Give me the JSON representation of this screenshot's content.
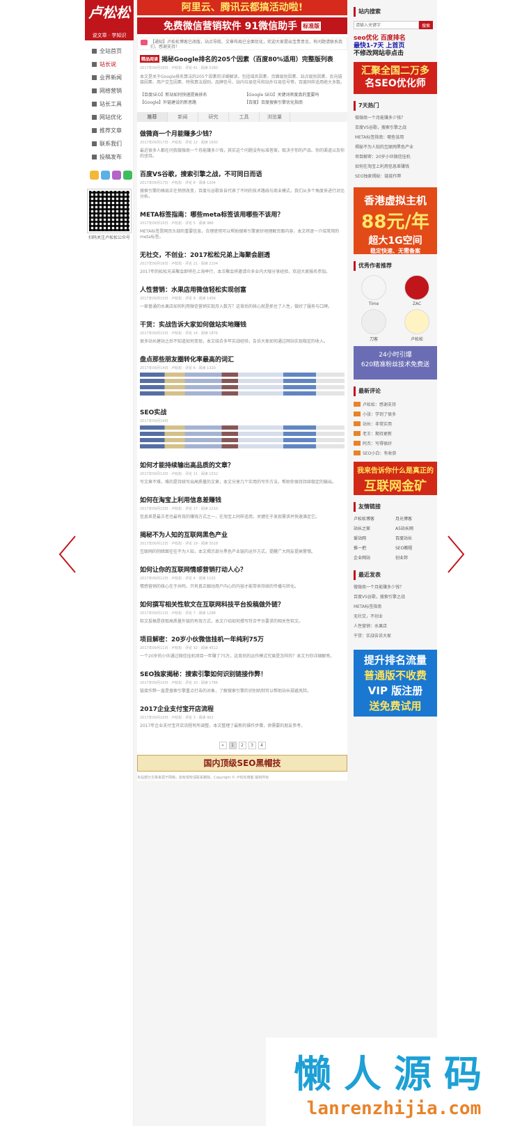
{
  "logo": {
    "text": "卢松松",
    "sub": "说文章 · 学知识"
  },
  "nav": [
    {
      "label": "全站首页",
      "active": false
    },
    {
      "label": "站长说",
      "active": true
    },
    {
      "label": "业界新闻",
      "active": false
    },
    {
      "label": "网络营销",
      "active": false
    },
    {
      "label": "站长工具",
      "active": false
    },
    {
      "label": "网站优化",
      "active": false
    },
    {
      "label": "推荐文章",
      "active": false
    },
    {
      "label": "联系我们",
      "active": false
    },
    {
      "label": "投稿发布",
      "active": false
    }
  ],
  "qr_caption": "扫码关注卢松松公众号",
  "banner1": "阿里云、腾讯云都搞活动啦!",
  "banner2": {
    "text": "免费微信营销软件   91微信助手",
    "tag": "标准版"
  },
  "notice": "【通知】卢松松博客已改版，站点导航、文章布局已全面优化，欢迎大家提出宝贵意见，有问题请联系我们，感谢支持！",
  "featured": {
    "badge": "精品阅读",
    "title": "揭秘Google排名的205个因素（百度80%适用）完整版列表",
    "meta": "2017年09月18日 · 卢松松 · 评论 41 · 阅读 5280",
    "summary": "本文是关于Google排名算法的205个因素的详细解读，包括域名因素、页面级别因素、站点级别因素、反向链接因素、用户交互因素、特殊算法规则、品牌信号、站内垃圾信号和站外垃圾信号等，百度同样适用绝大多数。",
    "related": [
      "【百度SEO】新站如何快速提高排名",
      "【Google SEO】关键词密度真的重要吗",
      "【Google】外链建设的新思路",
      "【百度】百度搜索引擎优化指南"
    ]
  },
  "tabs": [
    "推荐",
    "新闻",
    "研究",
    "工具",
    "浏览量"
  ],
  "posts": [
    {
      "title": "做微商一个月能赚多少钱？",
      "meta": "2017年09月17日 · 卢松松 · 评论 12 · 阅读 1630",
      "body": "最近很多人都在问我做微商一个月能赚多少钱，其实这个问题没有标准答案，取决于你的产品、你的渠道以及你的坚持。"
    },
    {
      "title": "百度VS谷歌，搜索引擎之战，不可同日而语",
      "meta": "2017年09月17日 · 卢松松 · 评论 8 · 阅读 1204",
      "body": "搜索引擎的格局正在悄然改变，百度与谷歌各自代表了不同的技术路线与商业模式，我们从多个角度来进行对比分析。"
    },
    {
      "title": "META标签指南：哪些meta标签该用哪些不该用？",
      "meta": "2017年09月16日 · 卢松松 · 评论 5 · 阅读 986",
      "body": "META标签是网页头部的重要信息，合理使用可以帮助搜索引擎更好地理解页面内容，本文将逐一介绍常用的meta标签。"
    },
    {
      "title": "无社交，不创业：2017松松兄弟上海聚会剧透",
      "meta": "2017年09月16日 · 卢松松 · 评论 21 · 阅读 2104",
      "body": "2017年的松松兄弟聚会即将在上海举行，本次聚会将邀请众多业内大咖分享经验，欢迎大家报名参加。"
    },
    {
      "title": "人性营销：水果店用微信轻松实现创富",
      "meta": "2017年09月15日 · 卢松松 · 评论 9 · 阅读 1456",
      "body": "一家普通的水果店如何利用微信营销实现月入数万？这背后的核心就是抓住了人性，做好了服务与口碑。"
    },
    {
      "title": "干货：实战告诉大家如何做站实地赚钱",
      "meta": "2017年09月15日 · 卢松松 · 评论 14 · 阅读 1876",
      "body": "很多站长建站之后不知道如何变现，本文结合多年实战经验，告诉大家如何通过网站实现稳定的收入。"
    },
    {
      "title": "盘点那些朋友圈转化率最高的词汇",
      "meta": "2017年09月14日 · 卢松松 · 评论 6 · 阅读 1320",
      "body": ""
    },
    {
      "title": "SEO实战",
      "meta": "2017年09月14日",
      "body": ""
    },
    {
      "title": "如何才能持续输出高品质的文章？",
      "meta": "2017年09月13日 · 卢松松 · 评论 11 · 阅读 1532",
      "body": "写文章不难，难的是持续写出高质量的文章，本文分享几个实用的写作方法，帮助你保持持续稳定的输出。"
    },
    {
      "title": "如何在淘宝上利用信息差赚钱",
      "meta": "2017年09月13日 · 卢松松 · 评论 17 · 阅读 2210",
      "body": "信息差是最古老也最有效的赚钱方式之一，在淘宝上同样适用，关键在于发现需求并快速满足它。"
    },
    {
      "title": "揭秘不为人知的互联网黑色产业",
      "meta": "2017年09月12日 · 卢松松 · 评论 19 · 阅读 3018",
      "body": "互联网的阴暗面往往不为人知，本文揭示部分黑色产业链的运作方式，提醒广大网友提高警惕。"
    },
    {
      "title": "如何让你的互联网情感营销打动人心？",
      "meta": "2017年09月12日 · 卢松松 · 评论 4 · 阅读 1102",
      "body": "情感营销的核心在于共鸣，只有真正触动用户内心的内容才能带来持续的传播与转化。"
    },
    {
      "title": "如何撰写相关性软文在互联网科技平台投稿做外链？",
      "meta": "2017年09月11日 · 卢松松 · 评论 7 · 阅读 1288",
      "body": "软文投稿是获取高质量外链的有效方式，本文介绍如何撰写符合平台要求的相关性软文。"
    },
    {
      "title": "项目解密：20岁小伙微信挂机一年纯利75万",
      "meta": "2017年09月11日 · 卢松松 · 评论 32 · 阅读 4512",
      "body": "一个20岁的小伙通过微信挂机项目一年赚了75万，这背后的运作模式究竟是怎样的？本文为你详细解密。"
    },
    {
      "title": "SEO独家揭秘：搜索引擎如何识别链接作弊！",
      "meta": "2017年09月10日 · 卢松松 · 评论 10 · 阅读 1766",
      "body": "链接作弊一直是搜索引擎重点打击的对象，了解搜索引擎的识别机制可以帮助站长规避风险。"
    },
    {
      "title": "2017企业支付宝开店流程",
      "meta": "2017年09月10日 · 卢松松 · 评论 3 · 阅读 902",
      "body": "2017年企业支付宝开店流程有所调整，本文整理了最新的操作步骤，供需要的朋友参考。"
    }
  ],
  "pager": [
    "«",
    "1",
    "2",
    "3",
    "4"
  ],
  "bottom_ad": "国内顶级SEO黑帽技",
  "footer": "本站部分文章来源于网络，如有侵权请联系删除。Copyright © 卢松松博客 版权所有",
  "right": {
    "search_title": "站内搜索",
    "search_placeholder": "请输入关键字",
    "search_button": "搜索",
    "seo_ad": [
      "seo优化 百度排名",
      "最快1-7天 上首页",
      "不修改网站非点击"
    ],
    "red_ad": [
      "汇聚全国二万多",
      "名SEO优化师"
    ],
    "hot_title": "7天热门",
    "hot": [
      "做微商一个月能赚多少钱？",
      "百度VS谷歌，搜索引擎之战",
      "META标签指南：哪些该用",
      "揭秘不为人知的互联网黑色产业",
      "项目解密：20岁小伙微信挂机",
      "如何在淘宝上利用信息差赚钱",
      "SEO独家揭秘：链接作弊"
    ],
    "hk_ad": [
      "香港虚拟主机",
      "88元/年",
      "超大1G空间",
      "稳定快速、无需备案"
    ],
    "authors_title": "优秀作者推荐",
    "authors": [
      {
        "name": "Time",
        "color": "#f5f5f5"
      },
      {
        "name": "ZAC",
        "color": "#c0151b"
      },
      {
        "name": "刀客",
        "color": "#eee"
      },
      {
        "name": "卢松松",
        "color": "#fff3c4"
      }
    ],
    "purple_ad": [
      "24小时引爆",
      "620精准粉丝技术免费送"
    ],
    "comment_title": "最新评论",
    "comments": [
      "卢松松：感谢支持",
      "小张：学到了很多",
      "站长：非常实用",
      "老王：期待更新",
      "阿杰：写得很好",
      "SEO小白：有收获"
    ],
    "gold_ad": [
      "我来告诉你什么是真正的",
      "互联网金矿"
    ],
    "links_title": "友情链接",
    "links": [
      "卢松松博客",
      "月光博客",
      "站长之家",
      "A5站长网",
      "爱站网",
      "百度站长",
      "推一把",
      "SEO教程",
      "企业网站",
      "创业邦"
    ],
    "recent_title": "最近发表",
    "recent": [
      "做微商一个月能赚多少钱？",
      "百度VS谷歌，搜索引擎之战",
      "META标签指南",
      "无社交，不创业",
      "人性营销：水果店",
      "干货：实战告诉大家"
    ],
    "blue_ad": [
      "提升排名流量",
      "普通版不收费",
      "VIP 版注册",
      "送免费试用"
    ]
  },
  "watermark": {
    "cn": "懒人源码",
    "en": "lanrenzhijia.com"
  },
  "colors": {
    "brand_red": "#c0151b",
    "watermark_blue": "#1da0d6",
    "watermark_orange": "#e8832a"
  }
}
